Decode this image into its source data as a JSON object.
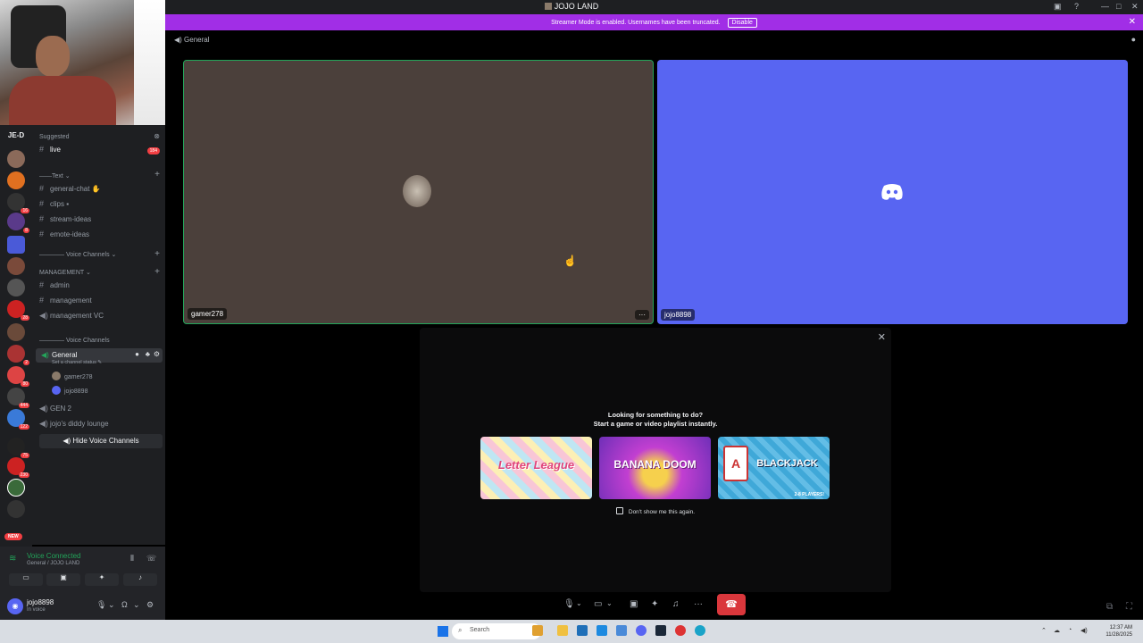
{
  "window": {
    "title": "JOJO LAND"
  },
  "banner": {
    "text": "Streamer Mode is enabled. Usernames have been truncated.",
    "button": "Disable"
  },
  "servers": {
    "header": "JE-D",
    "badges": [
      "16",
      "8",
      "28",
      "2",
      "80",
      "444",
      "122",
      "75",
      "230"
    ],
    "new_label": "NEW"
  },
  "channels": {
    "suggested_label": "Suggested",
    "live_channel": "live",
    "live_count": "184",
    "text_category": "Text",
    "text_channels": [
      "general-chat",
      "clips",
      "stream-ideas",
      "emote-ideas"
    ],
    "voice_category": "Voice Channels",
    "management_category": "MANAGEMENT",
    "management_channels": [
      "admin",
      "management",
      "management VC"
    ],
    "voice_category_2": "Voice Channels",
    "general_voice": "General",
    "general_status": "Set a channel status",
    "voice_users": [
      "gamer278",
      "jojo8898"
    ],
    "other_voice": [
      "GEN 2",
      "jojo's diddy lounge"
    ],
    "hide_voice": "Hide Voice Channels"
  },
  "voice_panel": {
    "status": "Voice Connected",
    "location": "General / JOJO LAND"
  },
  "user_panel": {
    "name": "jojo8898",
    "status": "In voice"
  },
  "main": {
    "channel_title": "General",
    "tiles": [
      {
        "name": "gamer278"
      },
      {
        "name": "jojo8898"
      }
    ],
    "activity": {
      "title_line1": "Looking for something to do?",
      "title_line2": "Start a game or video playlist instantly.",
      "games": [
        "Letter League",
        "BANANA DOOM",
        "BLACKJACK"
      ],
      "game3_subtitle": "2-8 PLAYERS!",
      "dont_show": "Don't show me this again."
    }
  },
  "taskbar": {
    "search_placeholder": "Search",
    "time": "12:37 AM",
    "date": "11/28/2025"
  },
  "colors": {
    "discord_blurple": "#5865f2",
    "streamer_banner": "#a12ee6",
    "voice_green": "#23a55a",
    "end_call_red": "#da373c"
  }
}
